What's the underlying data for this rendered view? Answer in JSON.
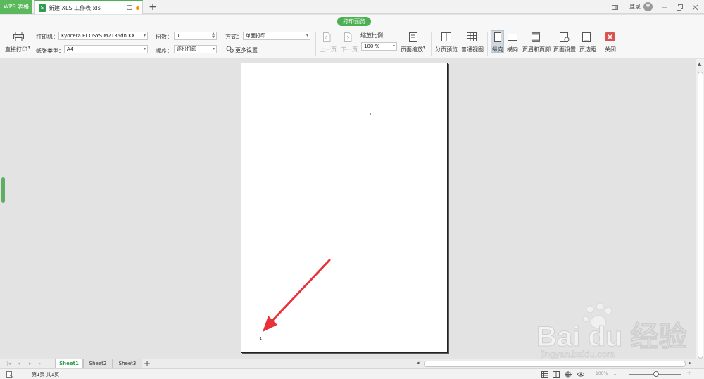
{
  "titlebar": {
    "app_name": "WPS 表格",
    "doc_tab": "新建 XLS 工作表.xls",
    "new_tab_glyph": "+",
    "login": "登录"
  },
  "ribbon": {
    "mode_label": "打印预览",
    "print_direct": "直接打印",
    "printer_label": "打印机：",
    "printer_value": "Kyocera ECOSYS M2135dn KX",
    "paper_label": "纸张类型：",
    "paper_value": "A4",
    "copies_label": "份数：",
    "copies_value": "1",
    "order_label": "顺序：",
    "order_value": "逐份打印",
    "method_label": "方式：",
    "method_value": "单面打印",
    "more_settings": "更多设置",
    "prev_page": "上一页",
    "next_page": "下一页",
    "scale_label": "缩放比例:",
    "scale_value": "100 %",
    "page_scale": "页面缩放",
    "page_break_preview": "分页预览",
    "normal_view": "普通视图",
    "portrait": "纵向",
    "landscape": "横向",
    "header_footer": "页眉和页脚",
    "page_setup": "页面设置",
    "margins": "页边距",
    "close": "关闭"
  },
  "preview": {
    "header_mark": "1",
    "footer_mark": "1"
  },
  "sheets": {
    "tabs": [
      "Sheet1",
      "Sheet2",
      "Sheet3"
    ],
    "active": "Sheet1"
  },
  "status": {
    "page_info": "第1页 共1页",
    "zoom": "100%"
  },
  "watermark": {
    "brand": "Bai du 经验",
    "url": "jingyan.baidu.com"
  },
  "colors": {
    "accent_green": "#4caf50",
    "arrow_red": "#e8323a",
    "close_red": "#d9534f"
  }
}
